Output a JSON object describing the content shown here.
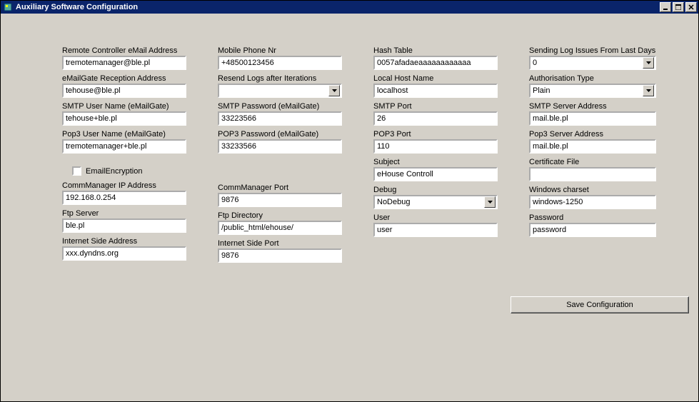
{
  "window": {
    "title": "Auxiliary Software Configuration"
  },
  "col1": {
    "remote_email_label": "Remote Controller eMail Address",
    "remote_email": "tremotemanager@ble.pl",
    "recep_label": "eMailGate Reception Address",
    "recep": "tehouse@ble.pl",
    "smtp_user_label": "SMTP User Name (eMailGate)",
    "smtp_user": "tehouse+ble.pl",
    "pop3_user_label": "Pop3 User Name (eMailGate)",
    "pop3_user": "tremotemanager+ble.pl",
    "email_enc_label": "EmailEncryption",
    "cm_ip_label": "CommManager IP Address",
    "cm_ip": "192.168.0.254",
    "ftp_server_label": "Ftp Server",
    "ftp_server": "ble.pl",
    "inet_addr_label": "Internet Side Address",
    "inet_addr": "xxx.dyndns.org"
  },
  "col2": {
    "mobile_label": "Mobile Phone Nr",
    "mobile": "+48500123456",
    "resend_label": "Resend Logs after Iterations",
    "resend": "",
    "smtp_pass_label": "SMTP Password (eMailGate)",
    "smtp_pass": "33223566",
    "pop3_pass_label": "POP3 Password (eMailGate)",
    "pop3_pass": "33233566",
    "cm_port_label": "CommManager Port",
    "cm_port": "9876",
    "ftp_dir_label": "Ftp Directory",
    "ftp_dir": "/public_html/ehouse/",
    "inet_port_label": "Internet Side Port",
    "inet_port": "9876"
  },
  "col3": {
    "hash_label": "Hash Table",
    "hash": "0057afadaeaaaaaaaaaaaa",
    "local_host_label": "Local Host Name",
    "local_host": "localhost",
    "smtp_port_label": "SMTP Port",
    "smtp_port": "26",
    "pop3_port_label": "POP3 Port",
    "pop3_port": "110",
    "subject_label": "Subject",
    "subject": "eHouse Controll",
    "debug_label": "Debug",
    "debug": "NoDebug",
    "user_label": "User",
    "user": "user"
  },
  "col4": {
    "send_log_label": "Sending Log Issues From Last Days",
    "send_log": "0",
    "auth_label": "Authorisation Type",
    "auth": "Plain",
    "smtp_server_label": "SMTP Server Address",
    "smtp_server": "mail.ble.pl",
    "pop3_server_label": "Pop3 Server Address",
    "pop3_server": "mail.ble.pl",
    "cert_label": "Certificate File",
    "cert": "",
    "charset_label": "Windows charset",
    "charset": "windows-1250",
    "password_label": "Password",
    "password": "password"
  },
  "buttons": {
    "save": "Save Configuration"
  }
}
